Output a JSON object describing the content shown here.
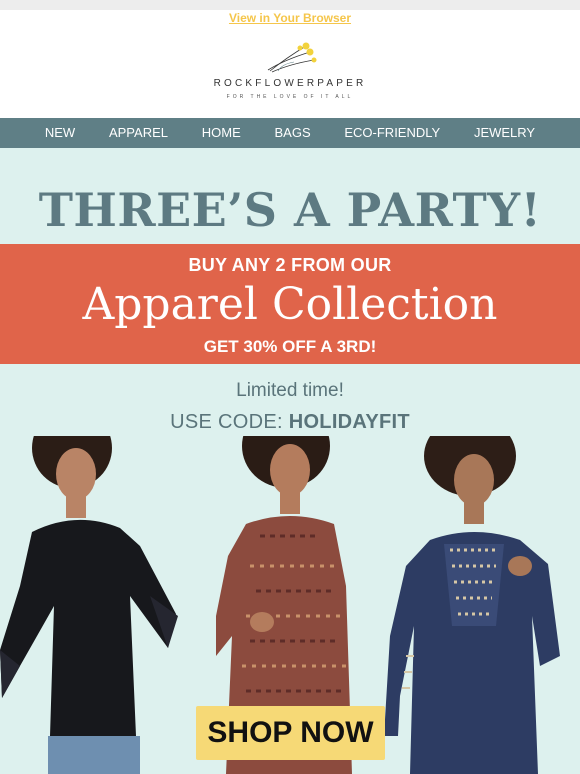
{
  "preheader": {
    "view_link": "View in Your Browser"
  },
  "header": {
    "brand": "ROCKFLOWERPAPER",
    "tagline": "FOR THE LOVE OF IT ALL"
  },
  "nav": {
    "items": [
      "NEW",
      "APPAREL",
      "HOME",
      "BAGS",
      "ECO-FRIENDLY",
      "JEWELRY"
    ]
  },
  "hero": {
    "headline": "THREE’S A PARTY!",
    "promo_top": "BUY ANY 2 FROM OUR",
    "promo_main": "Apparel Collection",
    "promo_bottom": "GET 30% OFF A 3RD!",
    "limited": "Limited time!",
    "code_prefix": "USE CODE: ",
    "code": "HOLIDAYFIT",
    "shop_button": "SHOP NOW"
  },
  "colors": {
    "nav_bg": "#5f7f86",
    "hero_bg": "#ddf1ee",
    "promo_bg": "#e0644a",
    "headline": "#5d7a82",
    "button_bg": "#f6d976",
    "link": "#f5c64b"
  },
  "icons": {
    "logo": "flower-logo-icon"
  }
}
